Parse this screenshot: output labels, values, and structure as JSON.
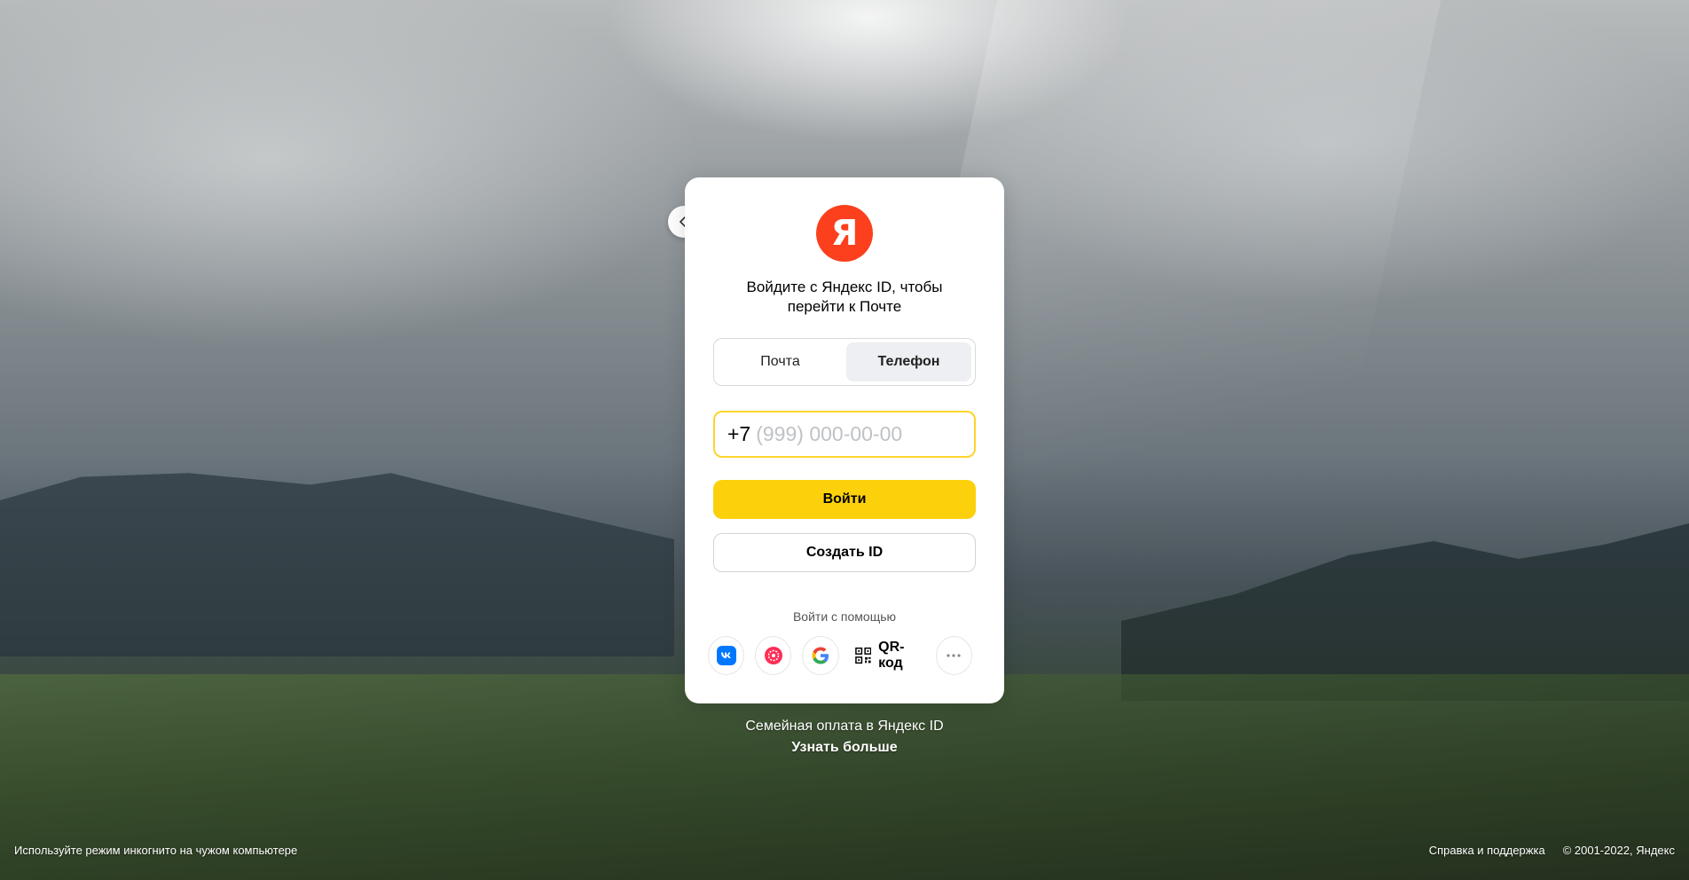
{
  "card": {
    "logo_letter": "Я",
    "heading_line1": "Войдите с Яндекс ID, чтобы",
    "heading_line2": "перейти к Почте"
  },
  "tabs": [
    {
      "label": "Почта",
      "active": false
    },
    {
      "label": "Телефон",
      "active": true
    }
  ],
  "phone": {
    "prefix": "+7",
    "value": "",
    "placeholder": "(999) 000-00-00"
  },
  "buttons": {
    "login": "Войти",
    "create": "Создать ID"
  },
  "social": {
    "label": "Войти с помощью",
    "qr_label": "QR-код",
    "providers": [
      "vk-icon",
      "ok-icon",
      "google-icon",
      "more-icon"
    ]
  },
  "promo": {
    "text": "Семейная оплата в Яндекс ID",
    "link": "Узнать больше"
  },
  "footer": {
    "incognito": "Используйте режим инкогнито на чужом компьютере",
    "help": "Справка и поддержка",
    "copyright": "© 2001-2022, Яндекс"
  },
  "colors": {
    "accent_yellow": "#fcd10c",
    "logo_red": "#fc3f1d",
    "field_border": "#fed42b"
  }
}
